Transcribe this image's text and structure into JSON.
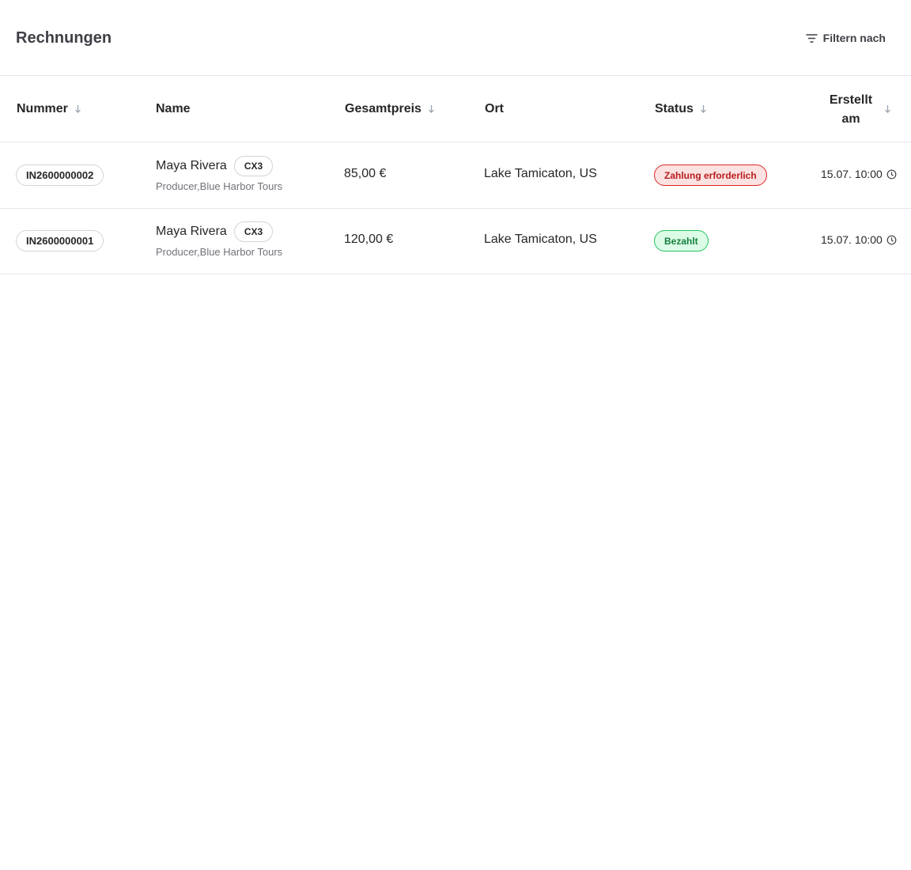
{
  "header": {
    "title": "Rechnungen",
    "filter_label": "Filtern nach",
    "filter_icon": "filter-lines-icon"
  },
  "table": {
    "columns": {
      "number": "Nummer",
      "name": "Name",
      "total": "Gesamtpreis",
      "location": "Ort",
      "status": "Status",
      "created_line1": "Erstellt",
      "created_line2": "am"
    },
    "rows": [
      {
        "number": "IN2600000002",
        "name": "Maya Rivera",
        "tag": "CX3",
        "subtitle": "Producer,Blue Harbor Tours",
        "total": "85,00 €",
        "location": "Lake Tamicaton, US",
        "status": "Zahlung erforderlich",
        "status_color": "#b91c1c",
        "created": "15.07. 10:00"
      },
      {
        "number": "IN2600000001",
        "name": "Maya Rivera",
        "tag": "CX3",
        "subtitle": "Producer,Blue Harbor Tours",
        "total": "120,00 €",
        "location": "Lake Tamicaton, US",
        "status": "Bezahlt",
        "status_color": "#15803d",
        "created": "15.07. 10:00"
      }
    ]
  },
  "colors": {
    "border": "#e5e7eb",
    "status_required_bg": "#fde2e2",
    "status_paid_bg": "#dcfce7"
  }
}
